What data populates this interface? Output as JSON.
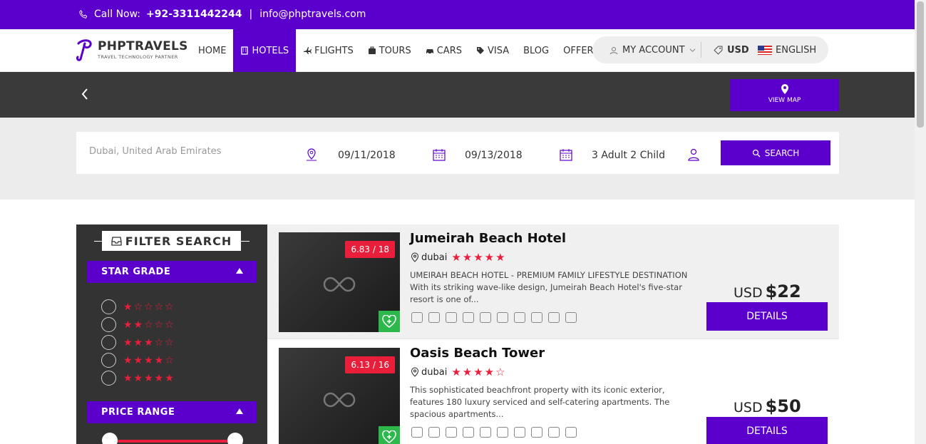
{
  "topbar": {
    "call_label": "Call Now:",
    "phone": "+92-3311442244",
    "separator": "|",
    "email": "info@phptravels.com"
  },
  "logo": {
    "brand": "PHPTRAVELS",
    "tagline": "TRAVEL TECHNOLOGY PARTNER"
  },
  "nav": {
    "items": [
      {
        "label": "HOME",
        "icon": ""
      },
      {
        "label": "HOTELS",
        "icon": "hotel-icon",
        "active": true
      },
      {
        "label": "FLIGHTS",
        "icon": "plane-icon"
      },
      {
        "label": "TOURS",
        "icon": "suitcase-icon"
      },
      {
        "label": "CARS",
        "icon": "car-icon"
      },
      {
        "label": "VISA",
        "icon": "tag-icon"
      },
      {
        "label": "BLOG",
        "icon": ""
      },
      {
        "label": "OFFERS",
        "icon": ""
      }
    ],
    "account": "MY ACCOUNT",
    "currency": "USD",
    "language": "ENGLISH"
  },
  "band": {
    "view_map": "VIEW MAP"
  },
  "search": {
    "location": "Dubai, United Arab Emirates",
    "checkin": "09/11/2018",
    "checkout": "09/13/2018",
    "guests": "3 Adult 2 Child",
    "button": "SEARCH"
  },
  "filters": {
    "title": "FILTER SEARCH",
    "star_grade": "STAR GRADE",
    "star_rows": [
      1,
      2,
      3,
      4,
      5
    ],
    "price_range": "PRICE RANGE"
  },
  "hotels": [
    {
      "name": "Jumeirah Beach Hotel",
      "city": "dubai",
      "stars": 5,
      "score": "6.83 / 18",
      "desc": "UMEIRAH BEACH HOTEL - PREMIUM FAMILY LIFESTYLE DESTINATION With its striking wave-like design, Jumeirah Beach Hotel's five-star resort is one of...",
      "currency": "USD",
      "price": "$22",
      "details": "DETAILS"
    },
    {
      "name": "Oasis Beach Tower",
      "city": "dubai",
      "stars": 4,
      "score": "6.13 / 16",
      "desc": "This sophisticated beachfront property with its iconic exterior, features 180 luxury serviced and self-catering apartments. The spacious apartments...",
      "currency": "USD",
      "price": "$50",
      "details": "DETAILS"
    }
  ],
  "colors": {
    "primary": "#5b00cc",
    "accent": "#e91e3a",
    "dark": "#333333",
    "wish": "#2db84b"
  }
}
